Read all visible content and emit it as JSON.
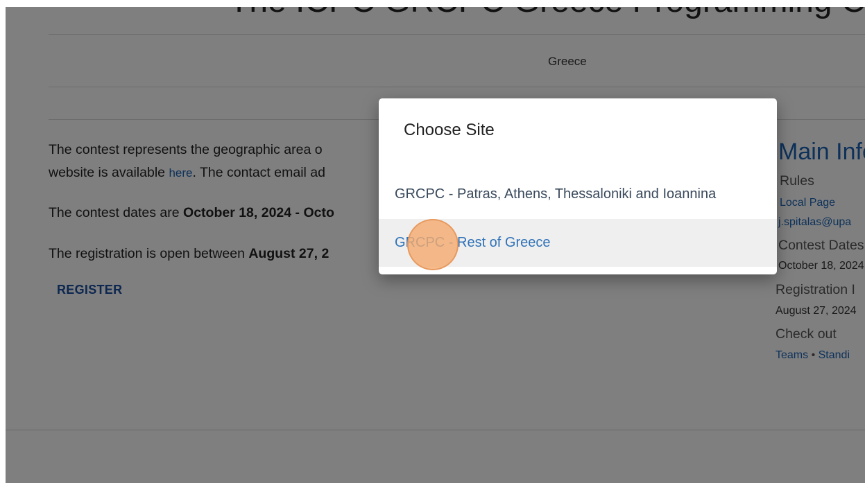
{
  "page": {
    "title": "The ICPC GRCPC Greece Programming Contest",
    "country": "Greece",
    "paragraph1_line1_prefix": "The contest represents the geographic area o",
    "paragraph1_line2_prefix": "website is available ",
    "paragraph1_here_link": "here",
    "paragraph1_line2_suffix": ". The contact email ad",
    "paragraph2_prefix": "The contest dates are ",
    "paragraph2_bold": "October 18, 2024 - Octo",
    "paragraph3_prefix": "The registration is open between ",
    "paragraph3_bold": "August 27, 2",
    "register_label": "REGISTER"
  },
  "sidebar": {
    "main_info": "Main Info",
    "rules": "Rules",
    "local_page": "Local Page",
    "email": "j.spitalas@upa",
    "contest_dates_label": "Contest Dates",
    "contest_dates_value": "October 18, 2024",
    "registration_label": "Registration I",
    "registration_value": "August 27, 2024",
    "check_out": "Check out",
    "teams": "Teams",
    "separator": " • ",
    "standings": "Standi"
  },
  "dialog": {
    "title": "Choose Site",
    "options": [
      "GRCPC - Patras, Athens, Thessaloniki and Ioannina",
      "GRCPC - Rest of Greece"
    ]
  },
  "colors": {
    "link": "#1a62b4",
    "overlay": "rgba(0,0,0,0.5)",
    "click_marker": "#f5aa6e"
  }
}
